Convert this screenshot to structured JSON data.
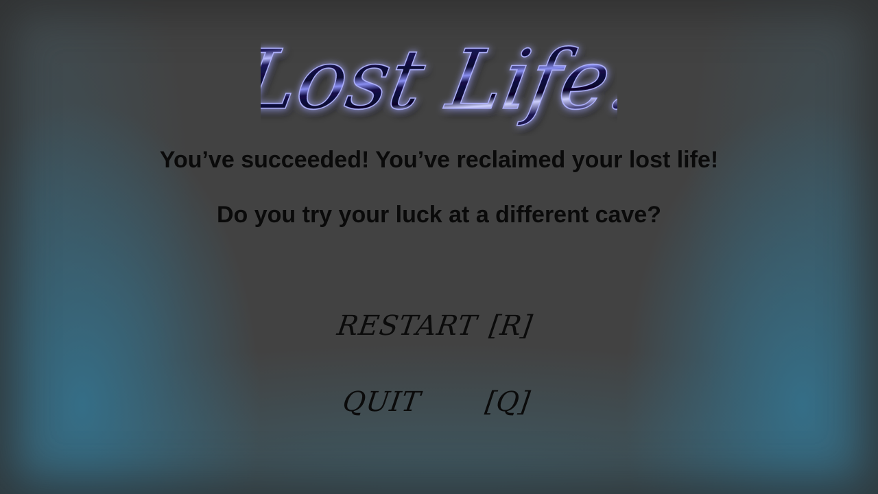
{
  "game": {
    "title": "Lost Life."
  },
  "message": {
    "line1": "You’ve succeeded!  You’ve reclaimed your lost life!",
    "line2": "Do you try your luck at a different cave?"
  },
  "menu": {
    "restart_label": "RESTART",
    "restart_key": "[R]",
    "quit_label": "QUIT",
    "quit_key": "[Q]"
  },
  "colors": {
    "background": "#424242",
    "glow": "#34708a",
    "logo_fill": "#1a1740",
    "logo_highlight": "#9aa0ff"
  }
}
